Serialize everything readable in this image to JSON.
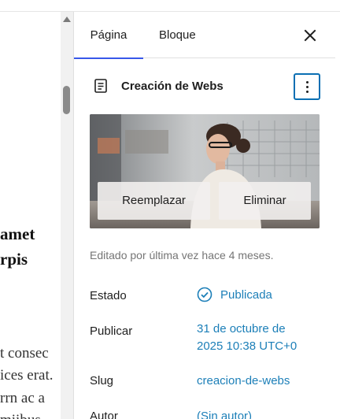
{
  "editor": {
    "heading_lines": [
      "amet",
      "rpis"
    ],
    "paragraph_lines": [
      "t consec",
      "ices erat.",
      "rrn ac a",
      "miibus"
    ]
  },
  "sidebar": {
    "tabs": [
      {
        "label": "Página",
        "active": true
      },
      {
        "label": "Bloque",
        "active": false
      }
    ],
    "document": {
      "title": "Creación de Webs",
      "icon": "page-icon"
    },
    "featured_image": {
      "replace_label": "Reemplazar",
      "remove_label": "Eliminar"
    },
    "last_edited": "Editado por última vez hace 4 meses.",
    "fields": {
      "status": {
        "label": "Estado",
        "value": "Publicada"
      },
      "publish": {
        "label": "Publicar",
        "value_line1": "31 de octubre de",
        "value_line2": "2025 10:38 UTC+0"
      },
      "slug": {
        "label": "Slug",
        "value": "creacion-de-webs"
      },
      "author": {
        "label": "Autor",
        "value": "(Sin autor)"
      }
    }
  },
  "colors": {
    "accent": "#3858e9",
    "link": "#1c7fb8",
    "focus": "#0a6fb3",
    "muted": "#757575"
  }
}
